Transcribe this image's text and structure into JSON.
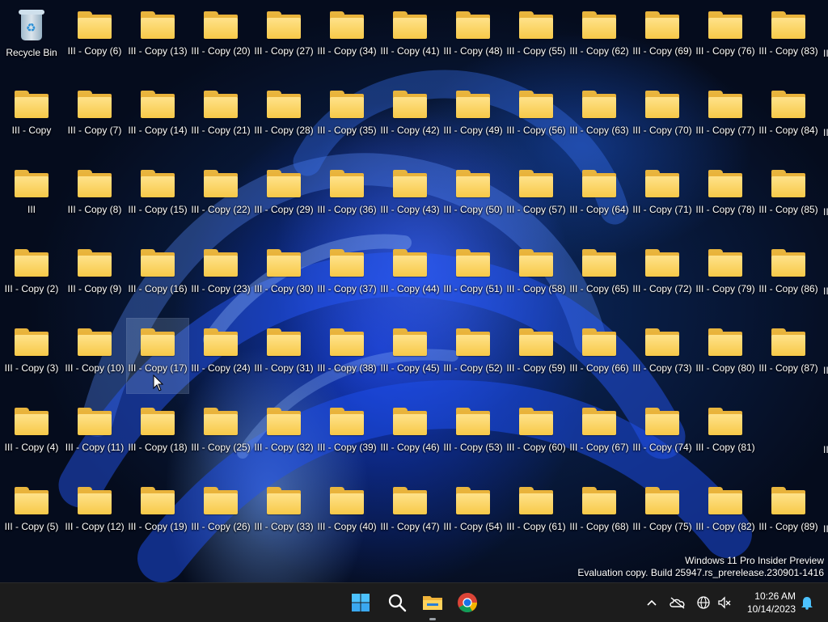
{
  "desktop": {
    "recycle_bin": {
      "label": "Recycle Bin",
      "icon": "recycle-bin-icon"
    },
    "folders": [
      [
        "III - Copy",
        "III",
        "III - Copy (2)",
        "III - Copy (3)",
        "III - Copy (4)",
        "III - Copy (5)"
      ],
      [
        "III - Copy (6)",
        "III - Copy (7)",
        "III - Copy (8)",
        "III - Copy (9)",
        "III - Copy (10)",
        "III - Copy (11)",
        "III - Copy (12)"
      ],
      [
        "III - Copy (13)",
        "III - Copy (14)",
        "III - Copy (15)",
        "III - Copy (16)",
        "III - Copy (17)",
        "III - Copy (18)",
        "III - Copy (19)"
      ],
      [
        "III - Copy (20)",
        "III - Copy (21)",
        "III - Copy (22)",
        "III - Copy (23)",
        "III - Copy (24)",
        "III - Copy (25)",
        "III - Copy (26)"
      ],
      [
        "III - Copy (27)",
        "III - Copy (28)",
        "III - Copy (29)",
        "III - Copy (30)",
        "III - Copy (31)",
        "III - Copy (32)",
        "III - Copy (33)"
      ],
      [
        "III - Copy (34)",
        "III - Copy (35)",
        "III - Copy (36)",
        "III - Copy (37)",
        "III - Copy (38)",
        "III - Copy (39)",
        "III - Copy (40)"
      ],
      [
        "III - Copy (41)",
        "III - Copy (42)",
        "III - Copy (43)",
        "III - Copy (44)",
        "III - Copy (45)",
        "III - Copy (46)",
        "III - Copy (47)"
      ],
      [
        "III - Copy (48)",
        "III - Copy (49)",
        "III - Copy (50)",
        "III - Copy (51)",
        "III - Copy (52)",
        "III - Copy (53)",
        "III - Copy (54)"
      ],
      [
        "III - Copy (55)",
        "III - Copy (56)",
        "III - Copy (57)",
        "III - Copy (58)",
        "III - Copy (59)",
        "III - Copy (60)",
        "III - Copy (61)"
      ],
      [
        "III - Copy (62)",
        "III - Copy (63)",
        "III - Copy (64)",
        "III - Copy (65)",
        "III - Copy (66)",
        "III - Copy (67)",
        "III - Copy (68)"
      ],
      [
        "III - Copy (69)",
        "III - Copy (70)",
        "III - Copy (71)",
        "III - Copy (72)",
        "III - Copy (73)",
        "III - Copy (74)",
        "III - Copy (75)"
      ],
      [
        "III - Copy (76)",
        "III - Copy (77)",
        "III - Copy (78)",
        "III - Copy (79)",
        "III - Copy (80)",
        "III - Copy (81)",
        "III - Copy (82)"
      ],
      [
        "III - Copy (83)",
        "III - Copy (84)",
        "III - Copy (85)",
        "III - Copy (86)",
        "III - Copy (87)",
        "",
        "III - Copy (89)"
      ]
    ],
    "partial_edge_label": "II",
    "hovered_folder": "III - Copy (17)",
    "watermark": {
      "line1": "Windows 11 Pro Insider Preview",
      "line2": "Evaluation copy. Build 25947.rs_prerelease.230901-1416"
    }
  },
  "taskbar": {
    "apps": [
      {
        "name": "start",
        "icon": "windows-start-icon"
      },
      {
        "name": "search",
        "icon": "search-icon"
      },
      {
        "name": "file-explorer",
        "icon": "file-explorer-icon"
      },
      {
        "name": "chrome",
        "icon": "chrome-icon"
      }
    ],
    "tray": {
      "overflow_icon": "chevron-up-icon",
      "onedrive_icon": "onedrive-offline-icon",
      "network_icon": "globe-network-icon",
      "volume_icon": "volume-muted-icon",
      "notification_icon": "notification-bell-icon"
    },
    "clock": {
      "time": "10:26 AM",
      "date": "10/14/2023"
    }
  },
  "colors": {
    "folder_yellow": "#f7c948",
    "taskbar_bg": "#1c1c1c",
    "accent_blue": "#1a73e8"
  }
}
